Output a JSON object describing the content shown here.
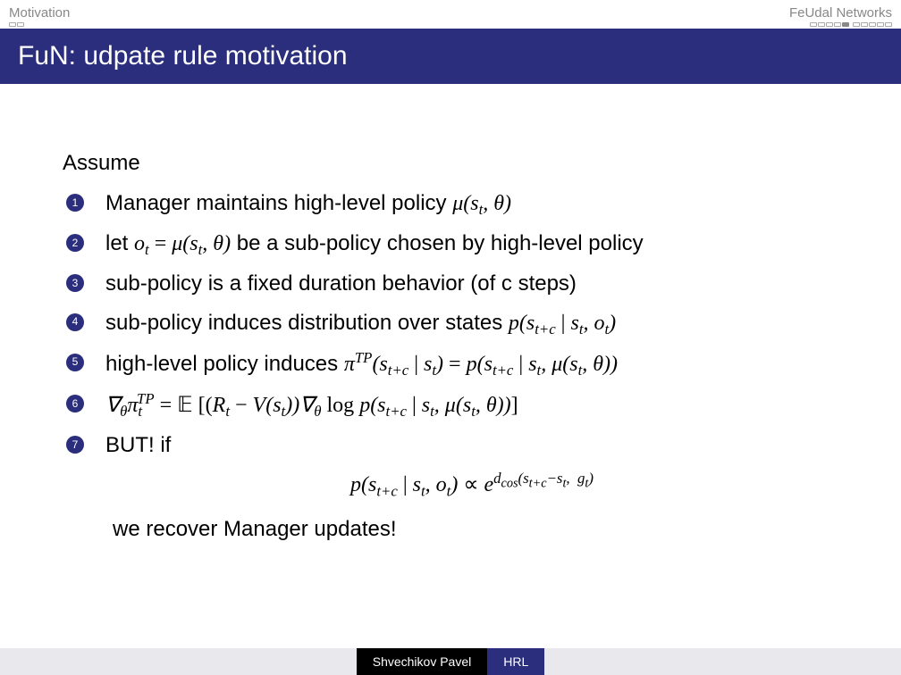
{
  "header": {
    "left_section": "Motivation",
    "right_section": "FeUdal Networks"
  },
  "nav": {
    "left_total": 2,
    "left_filled": 0,
    "right_groups": [
      {
        "total": 5,
        "filled_index": 4
      },
      {
        "total": 5,
        "filled_index": -1
      }
    ]
  },
  "title": "FuN: udpate rule motivation",
  "assume_label": "Assume",
  "items": [
    {
      "n": "1",
      "html": "Manager maintains high-level policy <span class='math'>μ(s<span class='sub'>t</span>, θ)</span>"
    },
    {
      "n": "2",
      "html": "let <span class='math'>o<span class='sub'>t</span> <span class='upright'>=</span> μ(s<span class='sub'>t</span>, θ)</span> be a sub-policy chosen by high-level policy"
    },
    {
      "n": "3",
      "html": "sub-policy is a fixed duration behavior (of c steps)"
    },
    {
      "n": "4",
      "html": "sub-policy induces distribution over states <span class='math'>p(s<span class='sub'>t+c</span> <span class='upright'>|</span> s<span class='sub'>t</span>, o<span class='sub'>t</span>)</span>"
    },
    {
      "n": "5",
      "html": "high-level policy induces <span class='math'>π<span class='sup'>TP</span>(s<span class='sub'>t+c</span> <span class='upright'>|</span> s<span class='sub'>t</span>) <span class='upright'>=</span> p(s<span class='sub'>t+c</span> <span class='upright'>|</span> s<span class='sub'>t</span>, μ(s<span class='sub'>t</span>, θ))</span>"
    },
    {
      "n": "6",
      "html": "<span class='math'>∇<span class='sub'>θ</span>π<span class='sub'>t</span><span class='sup' style='margin-left:-6px'>TP</span> <span class='upright'>=</span> <span class='bb'>𝔼</span> <span class='upright'>[(</span>R<span class='sub'>t</span> <span class='upright'>−</span> V(s<span class='sub'>t</span>))∇<span class='sub'>θ</span> <span class='upright'>log</span> p(s<span class='sub'>t+c</span> <span class='upright'>|</span> s<span class='sub'>t</span>, μ(s<span class='sub'>t</span>, θ))<span class='upright'>]</span></span>"
    },
    {
      "n": "7",
      "html": "BUT! if"
    }
  ],
  "equation_html": "p(s<span class='sub'>t+c</span> <span class='upright'>|</span> s<span class='sub'>t</span>, o<span class='sub'>t</span>) <span class='upright'>∝</span> e<span class='sup'>d<span class='sub' style='font-size:0.85em'>cos</span>(s<span class='sub' style='font-size:0.85em'>t+c</span>−s<span class='sub' style='font-size:0.85em'>t</span>,&nbsp;&nbsp;g<span class='sub' style='font-size:0.85em'>t</span>)</span>",
  "closing": "we recover Manager updates!",
  "footer": {
    "author": "Shvechikov Pavel",
    "short_title": "HRL"
  }
}
